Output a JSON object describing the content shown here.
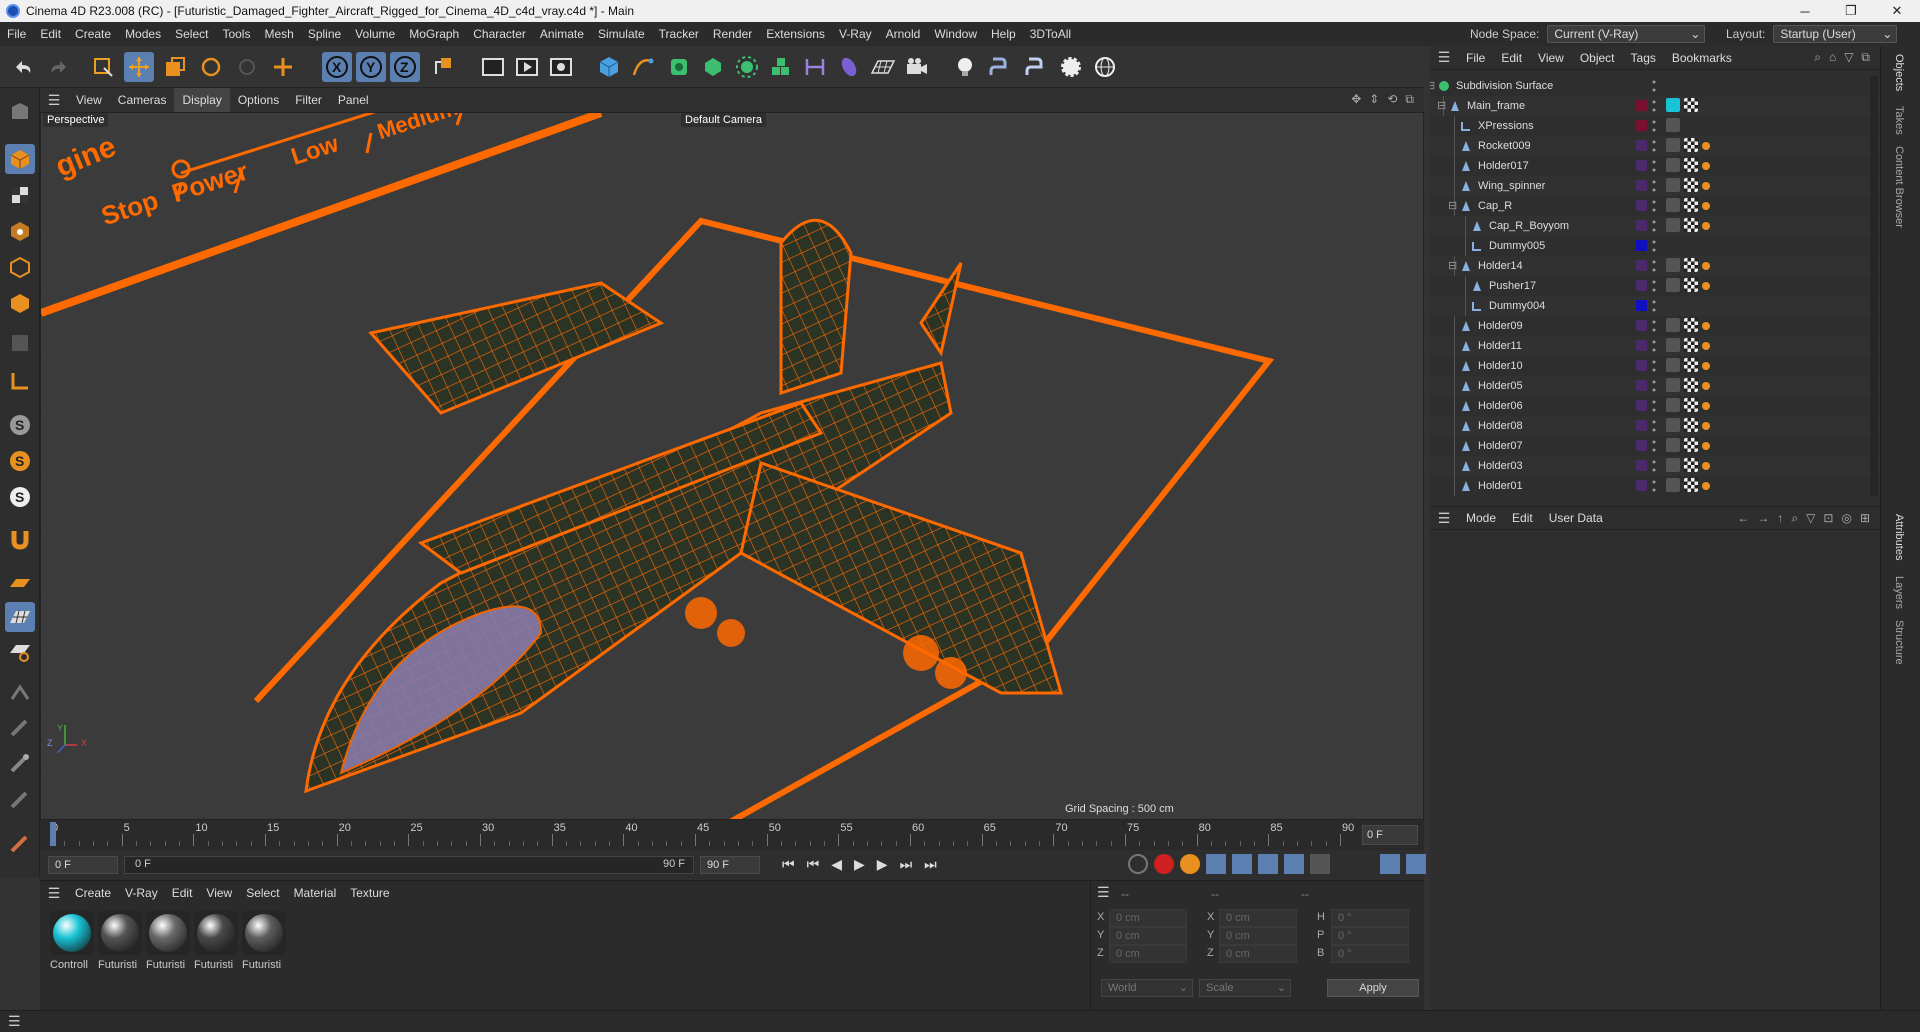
{
  "window": {
    "title": "Cinema 4D R23.008 (RC) - [Futuristic_Damaged_Fighter_Aircraft_Rigged_for_Cinema_4D_c4d_vray.c4d *] - Main",
    "minimize": "─",
    "maximize": "❐",
    "close": "✕"
  },
  "menubar": {
    "items": [
      "File",
      "Edit",
      "Create",
      "Modes",
      "Select",
      "Tools",
      "Mesh",
      "Spline",
      "Volume",
      "MoGraph",
      "Character",
      "Animate",
      "Simulate",
      "Tracker",
      "Render",
      "Extensions",
      "V-Ray",
      "Arnold",
      "Window",
      "Help",
      "3DToAll"
    ],
    "node_space_label": "Node Space:",
    "node_space_value": "Current (V-Ray)",
    "layout_label": "Layout:",
    "layout_value": "Startup (User)"
  },
  "viewport": {
    "menu": [
      "View",
      "Cameras",
      "Display",
      "Options",
      "Filter",
      "Panel"
    ],
    "active_menu": "Display",
    "view_name": "Perspective",
    "camera": "Default Camera",
    "grid_spacing": "Grid Spacing : 500 cm",
    "hud_labels": [
      "gine",
      "Stop",
      "Power",
      "Low",
      "Medium"
    ],
    "axis": {
      "x": "X",
      "y": "Y",
      "z": "Z"
    }
  },
  "timeline": {
    "ticks": [
      "0",
      "5",
      "10",
      "15",
      "20",
      "25",
      "30",
      "35",
      "40",
      "45",
      "50",
      "55",
      "60",
      "65",
      "70",
      "75",
      "80",
      "85",
      "90"
    ],
    "current_frame": "0 F",
    "start_field": "0 F",
    "range_start": "0 F",
    "range_end": "90 F",
    "end_field": "90 F"
  },
  "materials": {
    "menu": [
      "Create",
      "V-Ray",
      "Edit",
      "View",
      "Select",
      "Material",
      "Texture"
    ],
    "items": [
      {
        "label": "Controll",
        "color": "#19c3d6"
      },
      {
        "label": "Futuristi",
        "color": "#555555"
      },
      {
        "label": "Futuristi",
        "color": "#6a6a6a"
      },
      {
        "label": "Futuristi",
        "color": "#4a4a4a"
      },
      {
        "label": "Futuristi",
        "color": "#5e5e5e"
      }
    ]
  },
  "coordinates": {
    "header_left": "--",
    "header_mid": "--",
    "header_right": "--",
    "rows": [
      {
        "l1": "X",
        "v1": "0 cm",
        "l2": "X",
        "v2": "0 cm",
        "l3": "H",
        "v3": "0 °"
      },
      {
        "l1": "Y",
        "v1": "0 cm",
        "l2": "Y",
        "v2": "0 cm",
        "l3": "P",
        "v3": "0 °"
      },
      {
        "l1": "Z",
        "v1": "0 cm",
        "l2": "Z",
        "v2": "0 cm",
        "l3": "B",
        "v3": "0 °"
      }
    ],
    "space": "World",
    "mode": "Scale",
    "apply": "Apply"
  },
  "objects": {
    "menu": [
      "File",
      "Edit",
      "View",
      "Object",
      "Tags",
      "Bookmarks"
    ],
    "rows": [
      {
        "name": "Subdivision Surface",
        "indent": 0,
        "swatch": ""
      },
      {
        "name": "Main_frame",
        "indent": 1,
        "swatch": "#7a1030"
      },
      {
        "name": "XPressions",
        "indent": 2,
        "swatch": "#7a1030"
      },
      {
        "name": "Rocket009",
        "indent": 2,
        "swatch": "#4a2a6a"
      },
      {
        "name": "Holder017",
        "indent": 2,
        "swatch": "#4a2a6a"
      },
      {
        "name": "Wing_spinner",
        "indent": 2,
        "swatch": "#4a2a6a"
      },
      {
        "name": "Cap_R",
        "indent": 2,
        "swatch": "#4a2a6a"
      },
      {
        "name": "Cap_R_Boyyom",
        "indent": 3,
        "swatch": "#4a2a6a"
      },
      {
        "name": "Dummy005",
        "indent": 3,
        "swatch": "#1010c0"
      },
      {
        "name": "Holder14",
        "indent": 2,
        "swatch": "#4a2a6a"
      },
      {
        "name": "Pusher17",
        "indent": 3,
        "swatch": "#4a2a6a"
      },
      {
        "name": "Dummy004",
        "indent": 3,
        "swatch": "#1010c0"
      },
      {
        "name": "Holder09",
        "indent": 2,
        "swatch": "#4a2a6a"
      },
      {
        "name": "Holder11",
        "indent": 2,
        "swatch": "#4a2a6a"
      },
      {
        "name": "Holder10",
        "indent": 2,
        "swatch": "#4a2a6a"
      },
      {
        "name": "Holder05",
        "indent": 2,
        "swatch": "#4a2a6a"
      },
      {
        "name": "Holder06",
        "indent": 2,
        "swatch": "#4a2a6a"
      },
      {
        "name": "Holder08",
        "indent": 2,
        "swatch": "#4a2a6a"
      },
      {
        "name": "Holder07",
        "indent": 2,
        "swatch": "#4a2a6a"
      },
      {
        "name": "Holder03",
        "indent": 2,
        "swatch": "#4a2a6a"
      },
      {
        "name": "Holder01",
        "indent": 2,
        "swatch": "#4a2a6a"
      }
    ]
  },
  "attributes": {
    "menu": [
      "Mode",
      "Edit",
      "User Data"
    ]
  },
  "right_tabs": [
    "Objects",
    "Takes",
    "Content Browser",
    "Attributes",
    "Layers",
    "Structure"
  ]
}
